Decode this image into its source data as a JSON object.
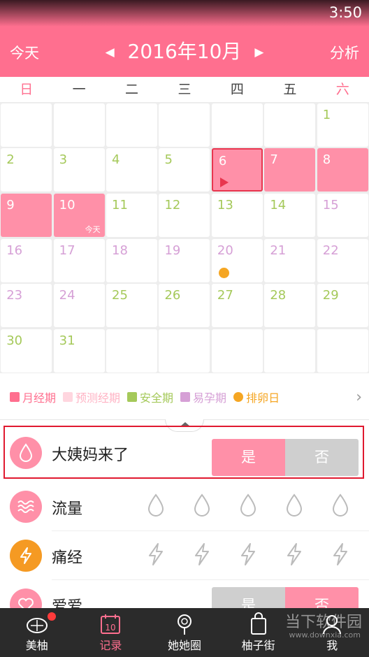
{
  "status_bar": {
    "time": "3:50"
  },
  "header": {
    "left": "今天",
    "title": "2016年10月",
    "right": "分析",
    "prev_arrow": "◀",
    "next_arrow": "▶"
  },
  "weekdays": [
    "日",
    "一",
    "二",
    "三",
    "四",
    "五",
    "六"
  ],
  "calendar": [
    [
      {
        "d": ""
      },
      {
        "d": ""
      },
      {
        "d": ""
      },
      {
        "d": ""
      },
      {
        "d": ""
      },
      {
        "d": ""
      },
      {
        "d": "1",
        "t": "safe"
      }
    ],
    [
      {
        "d": "2",
        "t": "safe"
      },
      {
        "d": "3",
        "t": "safe"
      },
      {
        "d": "4",
        "t": "safe"
      },
      {
        "d": "5",
        "t": "safe"
      },
      {
        "d": "6",
        "t": "period",
        "selected": true,
        "start": true
      },
      {
        "d": "7",
        "t": "period"
      },
      {
        "d": "8",
        "t": "period"
      }
    ],
    [
      {
        "d": "9",
        "t": "period"
      },
      {
        "d": "10",
        "t": "period",
        "today": "今天"
      },
      {
        "d": "11",
        "t": "safe"
      },
      {
        "d": "12",
        "t": "safe"
      },
      {
        "d": "13",
        "t": "safe"
      },
      {
        "d": "14",
        "t": "safe"
      },
      {
        "d": "15",
        "t": "fert"
      }
    ],
    [
      {
        "d": "16",
        "t": "fert"
      },
      {
        "d": "17",
        "t": "fert"
      },
      {
        "d": "18",
        "t": "fert"
      },
      {
        "d": "19",
        "t": "fert"
      },
      {
        "d": "20",
        "t": "fert",
        "ovulation": true
      },
      {
        "d": "21",
        "t": "fert"
      },
      {
        "d": "22",
        "t": "fert"
      }
    ],
    [
      {
        "d": "23",
        "t": "fert"
      },
      {
        "d": "24",
        "t": "fert"
      },
      {
        "d": "25",
        "t": "safe"
      },
      {
        "d": "26",
        "t": "safe"
      },
      {
        "d": "27",
        "t": "safe"
      },
      {
        "d": "28",
        "t": "safe"
      },
      {
        "d": "29",
        "t": "safe"
      }
    ],
    [
      {
        "d": "30",
        "t": "safe"
      },
      {
        "d": "31",
        "t": "safe"
      },
      {
        "d": ""
      },
      {
        "d": ""
      },
      {
        "d": ""
      },
      {
        "d": ""
      },
      {
        "d": ""
      }
    ]
  ],
  "legend": [
    {
      "label": "月经期",
      "color": "#ff6f8f"
    },
    {
      "label": "预测经期",
      "color": "#ffd6df"
    },
    {
      "label": "安全期",
      "color": "#a5c95a"
    },
    {
      "label": "易孕期",
      "color": "#d6a0d6"
    },
    {
      "label": "排卵日",
      "color": "#f5a623"
    }
  ],
  "records": {
    "period": {
      "label": "大姨妈来了",
      "yes": "是",
      "no": "否"
    },
    "flow": {
      "label": "流量"
    },
    "pain": {
      "label": "痛经"
    },
    "love": {
      "label": "爱爱",
      "yes": "是",
      "no": "否"
    }
  },
  "tabs": [
    {
      "label": "美柚",
      "icon": "meiyou-icon"
    },
    {
      "label": "记录",
      "icon": "calendar-icon",
      "active": true,
      "icon_text": "10"
    },
    {
      "label": "她她圈",
      "icon": "lollipop-icon"
    },
    {
      "label": "柚子街",
      "icon": "shopping-bag-icon"
    },
    {
      "label": "我",
      "icon": "profile-icon"
    }
  ],
  "watermark": {
    "text": "当下软件园",
    "sub": "www.downxia.com"
  }
}
